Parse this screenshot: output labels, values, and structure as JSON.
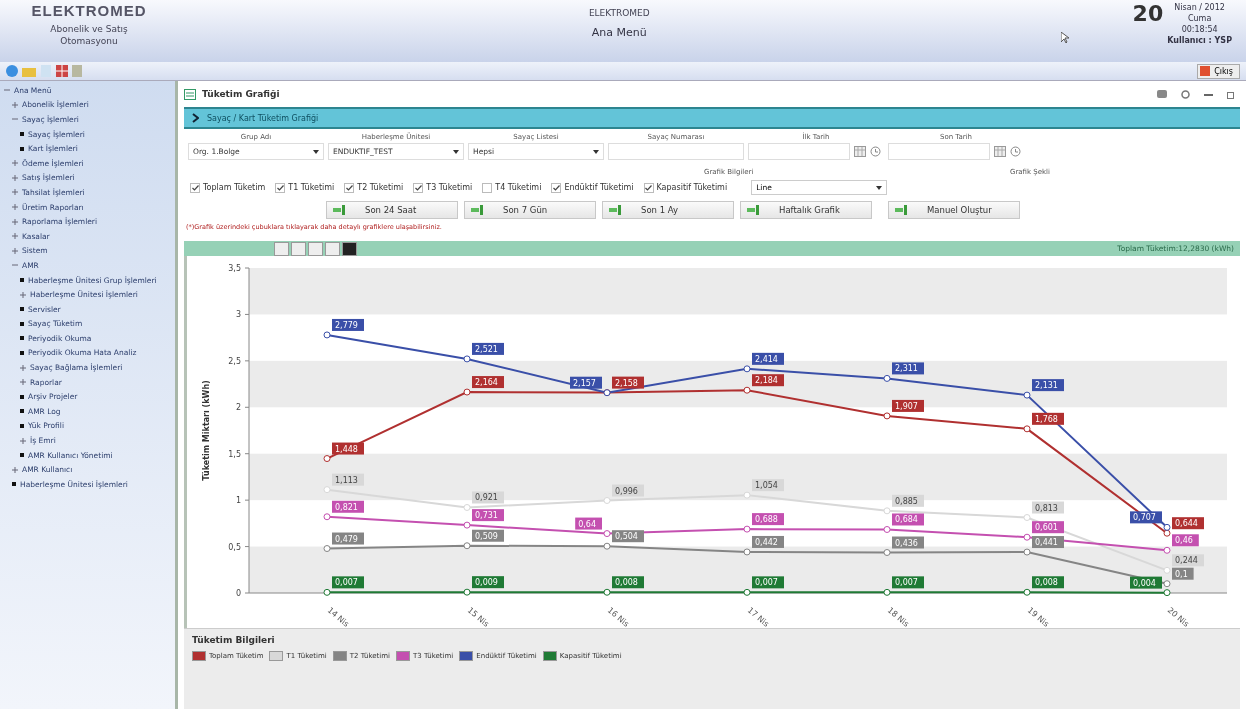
{
  "header": {
    "logo": "ELEKTROMED",
    "app_name": "Abonelik ve Satış Otomasyonu",
    "center_title": "ELEKTROMED",
    "center_subtitle": "Ana Menü",
    "day": "20",
    "month_year": "Nisan / 2012",
    "weekday": "Cuma",
    "time": "00:18:54",
    "user_label": "Kullanıcı :",
    "user": "YSP"
  },
  "exit_button": "Çıkış",
  "sidebar": {
    "items": [
      {
        "label": "Ana Menü",
        "expanded": true,
        "children": [
          {
            "label": "Abonelik İşlemleri",
            "expanded": false
          },
          {
            "label": "Sayaç İşlemleri",
            "expanded": true,
            "children": [
              {
                "label": "Sayaç İşlemleri"
              },
              {
                "label": "Kart İşlemleri"
              }
            ]
          },
          {
            "label": "Ödeme İşlemleri",
            "expanded": false
          },
          {
            "label": "Satış İşlemleri",
            "expanded": false
          },
          {
            "label": "Tahsilat İşlemleri",
            "expanded": false
          },
          {
            "label": "Üretim Raporları",
            "expanded": false
          },
          {
            "label": "Raporlama İşlemleri",
            "expanded": false
          },
          {
            "label": "Kasalar",
            "expanded": false
          },
          {
            "label": "Sistem",
            "expanded": false
          },
          {
            "label": "AMR",
            "expanded": true,
            "children": [
              {
                "label": "Haberleşme Ünitesi Grup İşlemleri"
              },
              {
                "label": "Haberleşme Ünitesi İşlemleri",
                "expanded": false
              },
              {
                "label": "Servisler"
              },
              {
                "label": "Sayaç Tüketim"
              },
              {
                "label": "Periyodik Okuma"
              },
              {
                "label": "Periyodik Okuma Hata Analiz"
              },
              {
                "label": "Sayaç Bağlama İşlemleri",
                "expanded": false
              },
              {
                "label": "Raporlar",
                "expanded": false
              },
              {
                "label": "Arşiv Projeler"
              },
              {
                "label": "AMR Log"
              },
              {
                "label": "Yük Profili"
              },
              {
                "label": "İş Emri",
                "expanded": false
              },
              {
                "label": "AMR Kullanıcı Yönetimi"
              }
            ]
          },
          {
            "label": "AMR Kullanıcı",
            "expanded": false
          },
          {
            "label": "Haberleşme Ünitesi İşlemleri"
          }
        ]
      }
    ]
  },
  "window": {
    "title": "Tüketim Grafiği",
    "breadcrumb": "Sayaç / Kart Tüketim Grafiği"
  },
  "filters": [
    {
      "label": "Grup Adı",
      "kind": "select",
      "value": "Org. 1.Bolge"
    },
    {
      "label": "Haberleşme Ünitesi",
      "kind": "select",
      "value": "ENDUKTIF_TEST"
    },
    {
      "label": "Sayaç Listesi",
      "kind": "select",
      "value": "Hepsi"
    },
    {
      "label": "Sayaç Numarası",
      "kind": "text"
    },
    {
      "label": "İlk Tarih",
      "kind": "date"
    },
    {
      "label": "Son Tarih",
      "kind": "date"
    }
  ],
  "graph_info_label": "Grafik Bilgileri",
  "graph_type": {
    "label": "Grafik Şekli",
    "value": "Line"
  },
  "checkboxes": [
    {
      "label": "Toplam Tüketim",
      "checked": true
    },
    {
      "label": "T1 Tüketimi",
      "checked": true
    },
    {
      "label": "T2 Tüketimi",
      "checked": true
    },
    {
      "label": "T3 Tüketimi",
      "checked": true
    },
    {
      "label": "T4 Tüketimi",
      "checked": false
    },
    {
      "label": "Endüktif Tüketimi",
      "checked": true
    },
    {
      "label": "Kapasitif Tüketimi",
      "checked": true
    }
  ],
  "buttons": [
    "Son 24 Saat",
    "Son 7 Gün",
    "Son 1 Ay",
    "Haftalık Grafik",
    "Manuel Oluştur"
  ],
  "note": "(*)Grafik üzerindeki çubuklara tıklayarak daha detaylı grafiklere ulaşabilirsiniz.",
  "total": "Toplam Tüketim:12,2830 (kWh)",
  "chart_data": {
    "type": "line",
    "ylabel": "Tüketim Miktarı (kWh)",
    "categories": [
      "14 Nis",
      "15 Nis",
      "16 Nis",
      "17 Nis",
      "18 Nis",
      "19 Nis",
      "20 Nis"
    ],
    "ylim": [
      0,
      3.5
    ],
    "yticks": [
      {
        "value": 0,
        "label": "0"
      },
      {
        "value": 0.5,
        "label": "0,5"
      },
      {
        "value": 1,
        "label": "1"
      },
      {
        "value": 1.5,
        "label": "1,5"
      },
      {
        "value": 2,
        "label": "2"
      },
      {
        "value": 2.5,
        "label": "2,5"
      },
      {
        "value": 3,
        "label": "3"
      },
      {
        "value": 3.5,
        "label": "3,5"
      }
    ],
    "data_labels": true,
    "series": [
      {
        "name": "Toplam Tüketim",
        "color": "#b03030",
        "marker": "circle",
        "values": [
          1.448,
          2.164,
          2.158,
          2.184,
          1.907,
          1.768,
          0.644
        ],
        "value_labels": [
          "1,448",
          "2,164",
          "2,158",
          "2,184",
          "1,907",
          "1,768",
          "0,644"
        ]
      },
      {
        "name": "T1 Tüketimi",
        "color": "#d8d8d8",
        "marker": "circle",
        "values": [
          1.113,
          0.921,
          0.996,
          1.054,
          0.885,
          0.813,
          0.244
        ],
        "value_labels": [
          "1,113",
          "0,921",
          "0,996",
          "1,054",
          "0,885",
          "0,813",
          "0,244"
        ]
      },
      {
        "name": "T2 Tüketimi",
        "color": "#858585",
        "marker": "circle",
        "values": [
          0.479,
          0.509,
          0.504,
          0.442,
          0.436,
          0.441,
          0.1
        ],
        "value_labels": [
          "0,479",
          "0,509",
          "0,504",
          "0,442",
          "0,436",
          "0,441",
          "0,1"
        ]
      },
      {
        "name": "T3 Tüketimi",
        "color": "#c450b0",
        "marker": "circle",
        "values": [
          0.821,
          0.731,
          0.64,
          0.688,
          0.684,
          0.601,
          0.46
        ],
        "value_labels": [
          "0,821",
          "0,731",
          "0,64",
          "0,688",
          "0,684",
          "0,601",
          "0,46"
        ]
      },
      {
        "name": "Endüktif Tüketimi",
        "color": "#3a4fa8",
        "marker": "circle",
        "values": [
          2.779,
          2.521,
          2.157,
          2.414,
          2.311,
          2.131,
          0.707
        ],
        "value_labels": [
          "2,779",
          "2,521",
          "2,157",
          "2,414",
          "2,311",
          "2,131",
          "0,707"
        ]
      },
      {
        "name": "Kapasitif Tüketimi",
        "color": "#1f7a35",
        "marker": "circle",
        "values": [
          0.007,
          0.009,
          0.008,
          0.007,
          0.007,
          0.008,
          0.004
        ],
        "value_labels": [
          "0,007",
          "0,009",
          "0,008",
          "0,007",
          "0,007",
          "0,008",
          "0,004"
        ]
      }
    ]
  },
  "info_title": "Tüketim Bilgileri"
}
